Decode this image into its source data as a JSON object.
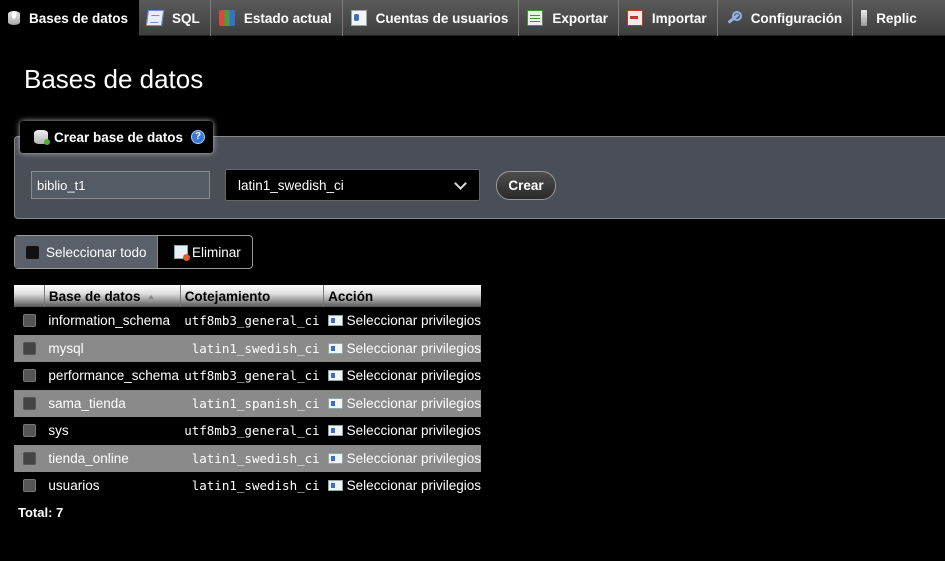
{
  "tabs": [
    {
      "label": "Bases de datos",
      "icon": "database-icon",
      "active": true
    },
    {
      "label": "SQL",
      "icon": "sql-icon"
    },
    {
      "label": "Estado actual",
      "icon": "status-chart-icon"
    },
    {
      "label": "Cuentas de usuarios",
      "icon": "user-accounts-icon"
    },
    {
      "label": "Exportar",
      "icon": "export-icon"
    },
    {
      "label": "Importar",
      "icon": "import-icon"
    },
    {
      "label": "Configuración",
      "icon": "wrench-icon"
    },
    {
      "label": "Replic",
      "icon": "replication-icon"
    }
  ],
  "page_title": "Bases de datos",
  "create": {
    "legend": "Crear base de datos",
    "help_glyph": "?",
    "name_value": "biblio_t1",
    "collation": "latin1_swedish_ci",
    "button": "Crear"
  },
  "bulk": {
    "select_all": "Seleccionar todo",
    "delete": "Eliminar"
  },
  "table": {
    "headers": [
      "Base de datos",
      "Cotejamiento",
      "Acción"
    ],
    "rows": [
      {
        "name": "information_schema",
        "collation": "utf8mb3_general_ci",
        "action": "Seleccionar privilegios"
      },
      {
        "name": "mysql",
        "collation": "latin1_swedish_ci",
        "action": "Seleccionar privilegios"
      },
      {
        "name": "performance_schema",
        "collation": "utf8mb3_general_ci",
        "action": "Seleccionar privilegios"
      },
      {
        "name": "sama_tienda",
        "collation": "latin1_spanish_ci",
        "action": "Seleccionar privilegios"
      },
      {
        "name": "sys",
        "collation": "utf8mb3_general_ci",
        "action": "Seleccionar privilegios"
      },
      {
        "name": "tienda_online",
        "collation": "latin1_swedish_ci",
        "action": "Seleccionar privilegios"
      },
      {
        "name": "usuarios",
        "collation": "latin1_swedish_ci",
        "action": "Seleccionar privilegios"
      }
    ]
  },
  "total": "Total: 7",
  "colors": {
    "accent_bg": "#4a4f57",
    "stripe": "#8a8a8a",
    "tabbar": "#4a4a4a"
  }
}
